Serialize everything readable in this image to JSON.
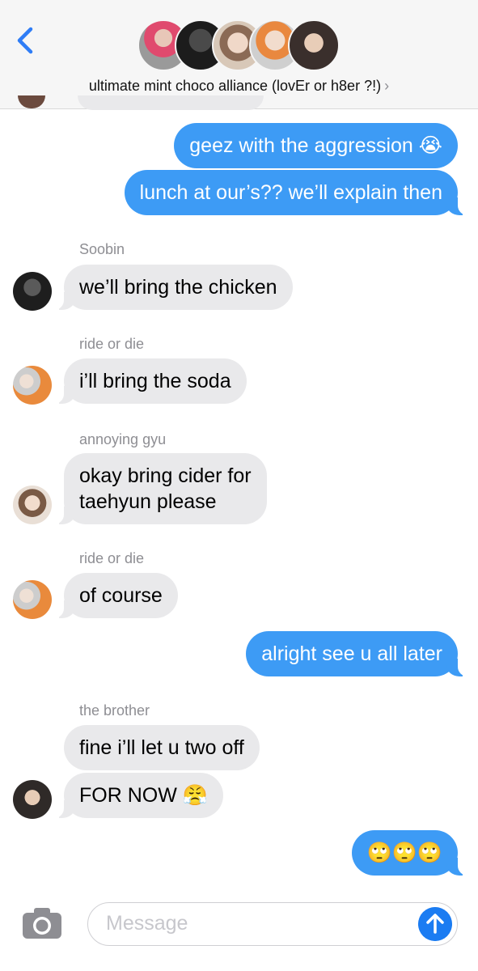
{
  "header": {
    "title": "ultimate mint choco alliance (lovEr or h8er ?!)",
    "chevron": "›",
    "back_icon": "chevron-left-icon",
    "accent": "#2f7df6"
  },
  "messages": {
    "m1": "geez with the aggression 😭",
    "m2": "lunch at our’s?? we’ll explain then",
    "s3": "Soobin",
    "m3": "we’ll bring the chicken",
    "s4": "ride or die",
    "m4": "i’ll bring the soda",
    "s5": "annoying gyu",
    "m5_line1": "okay bring cider for",
    "m5_line2": "taehyun please",
    "s6": "ride or die",
    "m6": "of course",
    "m7": "alright see u all later",
    "s8": "the brother",
    "m8": "fine i’ll let u two off",
    "m9": "FOR NOW 😤",
    "m10": "🙄🙄🙄"
  },
  "composer": {
    "placeholder": "Message",
    "camera_icon": "camera-icon",
    "send_icon": "arrow-up-icon"
  },
  "colors": {
    "outgoing_bubble": "#3d9bf5",
    "incoming_bubble": "#e9e9eb",
    "sender_label": "#8e8e93"
  }
}
